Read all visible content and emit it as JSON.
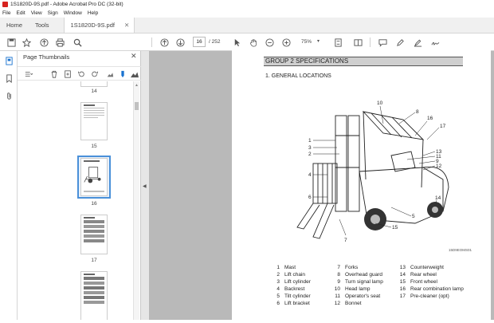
{
  "window": {
    "title": "1S1820D-9S.pdf - Adobe Acrobat Pro DC (32-bit)"
  },
  "menu": [
    "File",
    "Edit",
    "View",
    "Sign",
    "Window",
    "Help"
  ],
  "tabs": {
    "home": "Home",
    "tools": "Tools",
    "document": "1S1820D-9S.pdf"
  },
  "toolbar": {
    "page_current": "16",
    "page_total": "/ 252",
    "zoom": "75%"
  },
  "panel": {
    "title": "Page Thumbnails"
  },
  "thumbnails": [
    {
      "label": "14"
    },
    {
      "label": "15"
    },
    {
      "label": "16",
      "selected": true
    },
    {
      "label": "17"
    },
    {
      "label": ""
    }
  ],
  "document": {
    "section_heading": "GROUP 2  SPECIFICATIONS",
    "subheading": "1. GENERAL LOCATIONS",
    "image_code": "15D9EOMS01",
    "callouts": [
      "10",
      "8",
      "16",
      "17",
      "1",
      "3",
      "2",
      "13",
      "11",
      "9",
      "12",
      "4",
      "6",
      "14",
      "5",
      "15",
      "7"
    ],
    "legend": [
      {
        "num": "1",
        "text": "Mast"
      },
      {
        "num": "2",
        "text": "Lift chain"
      },
      {
        "num": "3",
        "text": "Lift cylinder"
      },
      {
        "num": "4",
        "text": "Backrest"
      },
      {
        "num": "5",
        "text": "Tilt cylinder"
      },
      {
        "num": "6",
        "text": "Lift bracket"
      },
      {
        "num": "7",
        "text": "Forks"
      },
      {
        "num": "8",
        "text": "Overhead guard"
      },
      {
        "num": "9",
        "text": "Turn signal lamp"
      },
      {
        "num": "10",
        "text": "Head lamp"
      },
      {
        "num": "11",
        "text": "Operator's seat"
      },
      {
        "num": "12",
        "text": "Bonnet"
      },
      {
        "num": "13",
        "text": "Counterweight"
      },
      {
        "num": "14",
        "text": "Rear wheel"
      },
      {
        "num": "15",
        "text": "Front wheel"
      },
      {
        "num": "16",
        "text": "Rear combination lamp"
      },
      {
        "num": "17",
        "text": "Pre-cleaner (opt)"
      }
    ]
  },
  "colors": {
    "accent": "#1a73d0",
    "selection": "#4a90d9",
    "doc_bg": "#b9b9b9",
    "app_icon": "#d7231f"
  }
}
